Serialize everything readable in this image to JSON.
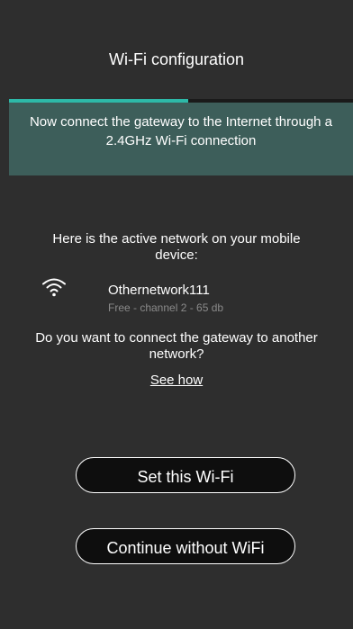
{
  "header": {
    "title": "Wi-Fi configuration"
  },
  "progress": {
    "fraction": 0.52,
    "color": "#2db9a8"
  },
  "banner": {
    "text": "Now connect the gateway to the Internet through a 2.4GHz Wi-Fi connection"
  },
  "active_network": {
    "label": "Here is the active network on your mobile device:",
    "icon": "wifi-icon",
    "name": "Othernetwork111",
    "details": "Free - channel 2 - 65 db"
  },
  "question": {
    "text": "Do you want to connect the gateway to another network?",
    "link": "See how"
  },
  "buttons": {
    "set_wifi": "Set this Wi-Fi",
    "continue_without": "Continue without WiFi"
  },
  "colors": {
    "background": "#2e2e2e",
    "banner": "#3d5e5a",
    "accent": "#2db9a8",
    "button_bg": "#0e0e0e"
  }
}
